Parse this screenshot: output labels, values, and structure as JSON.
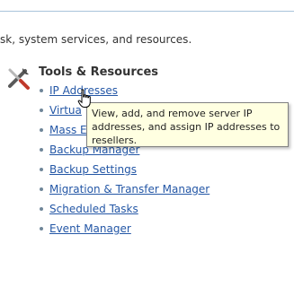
{
  "page": {
    "intro_text": "sk, system services, and resources."
  },
  "section": {
    "title": "Tools & Resources",
    "icon": "tools-wrench-screwdriver-icon"
  },
  "tools": {
    "items": [
      {
        "label": "IP Addresses"
      },
      {
        "label": "Virtua"
      },
      {
        "label": "Mass En"
      },
      {
        "label": "Backup Manager"
      },
      {
        "label": "Backup Settings"
      },
      {
        "label": "Migration & Transfer Manager"
      },
      {
        "label": "Scheduled Tasks"
      },
      {
        "label": "Event Manager"
      }
    ]
  },
  "tooltip": {
    "text": "View, add, and remove server IP addresses, and assign IP addresses to resellers."
  },
  "cursor": {
    "icon": "hand-pointer-cursor-icon"
  },
  "colors": {
    "link": "#2457a6",
    "tooltip_bg": "#ffffe1",
    "rule": "#a9c3da"
  }
}
